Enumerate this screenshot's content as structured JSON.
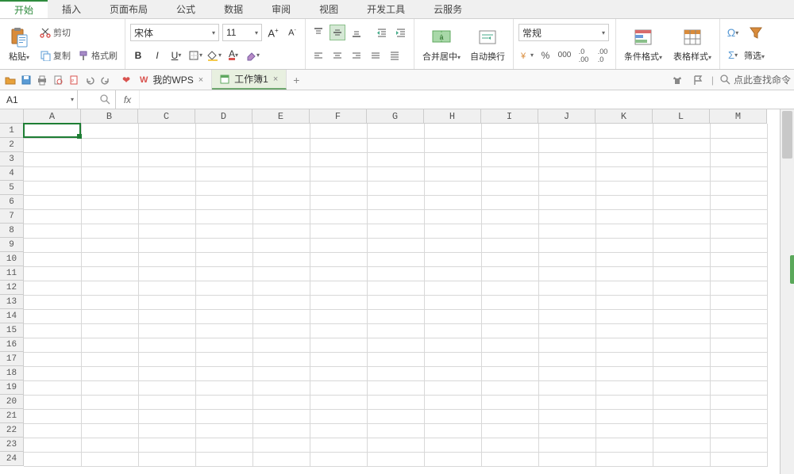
{
  "menu": {
    "tabs": [
      "开始",
      "插入",
      "页面布局",
      "公式",
      "数据",
      "审阅",
      "视图",
      "开发工具",
      "云服务"
    ],
    "active": "开始"
  },
  "ribbon": {
    "paste": "粘贴",
    "cut": "剪切",
    "copy": "复制",
    "format_painter": "格式刷",
    "font_name": "宋体",
    "font_size": "11",
    "merge_center": "合并居中",
    "auto_wrap": "自动换行",
    "number_format": "常规",
    "cond_fmt": "条件格式",
    "table_style": "表格样式",
    "filter": "筛选"
  },
  "quickbar": {
    "search_hint": "点此查找命令"
  },
  "doc_tabs": {
    "items": [
      {
        "label": "我的WPS",
        "icon": "wps"
      },
      {
        "label": "工作簿1",
        "icon": "xls"
      }
    ],
    "active": 1
  },
  "name_box": {
    "value": "A1"
  },
  "formula_bar": {
    "fx": "fx",
    "value": ""
  },
  "sheet": {
    "columns": [
      "A",
      "B",
      "C",
      "D",
      "E",
      "F",
      "G",
      "H",
      "I",
      "J",
      "K",
      "L",
      "M"
    ],
    "rows": [
      1,
      2,
      3,
      4,
      5,
      6,
      7,
      8,
      9,
      10,
      11,
      12,
      13,
      14,
      15,
      16,
      17,
      18,
      19,
      20,
      21,
      22,
      23,
      24
    ],
    "active_cell": "A1"
  }
}
